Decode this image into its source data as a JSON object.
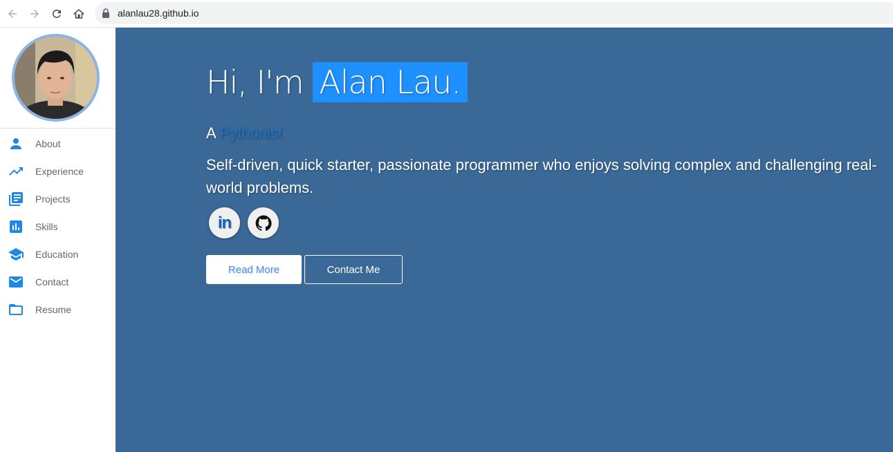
{
  "browser": {
    "url": "alanlau28.github.io"
  },
  "sidebar": {
    "items": [
      {
        "label": "About",
        "icon": "person-icon"
      },
      {
        "label": "Experience",
        "icon": "trending-up-icon"
      },
      {
        "label": "Projects",
        "icon": "library-books-icon"
      },
      {
        "label": "Skills",
        "icon": "bar-chart-icon"
      },
      {
        "label": "Education",
        "icon": "school-icon"
      },
      {
        "label": "Contact",
        "icon": "email-icon"
      },
      {
        "label": "Resume",
        "icon": "folder-icon"
      }
    ]
  },
  "hero": {
    "greeting": "Hi, I'm",
    "name": "Alan Lau.",
    "role_prefix": "A",
    "role": "Pythonist",
    "description": "Self-driven, quick starter, passionate programmer who enjoys solving complex and challenging real-world problems.",
    "linkedin_text": "in",
    "read_more": "Read More",
    "contact_me": "Contact Me"
  },
  "colors": {
    "accent": "#1e90ff",
    "hero_background": "#3a6997",
    "sidebar_icon": "#1e88e5"
  }
}
